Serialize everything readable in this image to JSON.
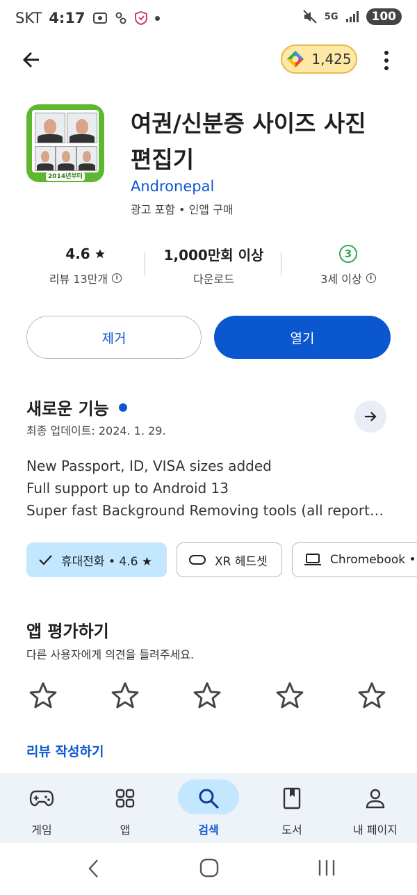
{
  "status_bar": {
    "carrier": "SKT",
    "time": "4:17",
    "network": "5G",
    "battery": "100"
  },
  "top_bar": {
    "points": "1,425"
  },
  "app": {
    "title": "여권/신분증 사이즈 사진 편집기",
    "developer": "Andronepal",
    "meta": "광고 포함  •  인앱 구매",
    "icon_label": "2014년부터"
  },
  "stats": {
    "rating": "4.6",
    "reviews": "리뷰 13만개",
    "downloads": "1,000만회 이상",
    "downloads_label": "다운로드",
    "age_badge": "3",
    "age_label": "3세 이상"
  },
  "buttons": {
    "remove": "제거",
    "open": "열기"
  },
  "whats_new": {
    "title": "새로운 기능",
    "updated": "최종 업데이트: 2024. 1. 29.",
    "lines": [
      "New Passport, ID, VISA sizes added",
      "Full support up to Android 13",
      "Super fast Background Removing tools (all reporte..."
    ]
  },
  "device_chips": [
    "휴대전화 • 4.6 ★",
    "XR 헤드셋",
    "Chromebook •"
  ],
  "rate": {
    "title": "앱 평가하기",
    "subtitle": "다른 사용자에게 의견을 들려주세요.",
    "write_review": "리뷰 작성하기"
  },
  "bottom_nav": [
    "게임",
    "앱",
    "검색",
    "도서",
    "내 페이지"
  ],
  "colors": {
    "accent": "#0b57d0",
    "chip_selected": "#c2e7ff",
    "nav_bg": "#eef2f9",
    "icon_green": "#5eb72f"
  }
}
